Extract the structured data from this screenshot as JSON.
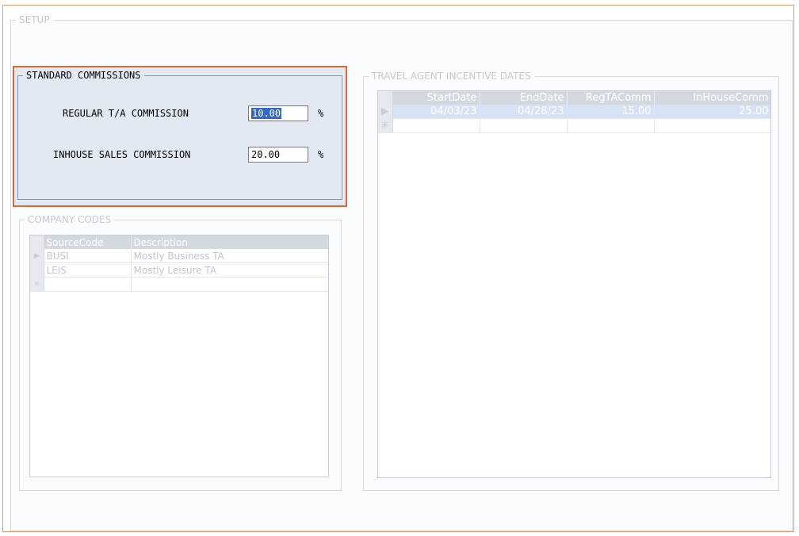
{
  "setup": {
    "title": "SETUP"
  },
  "standard_commissions": {
    "title": "STANDARD COMMISSIONS",
    "regular_label": "REGULAR T/A COMMISSION",
    "regular_value": "10.00",
    "inhouse_label": "INHOUSE SALES COMMISSION",
    "inhouse_value": "20.00",
    "percent_sign": "%"
  },
  "company_codes": {
    "title": "COMPANY CODES",
    "columns": [
      "SourceCode",
      "Description"
    ],
    "rows": [
      {
        "code": "BUSI",
        "description": "Mostly Business TA"
      },
      {
        "code": "LEIS",
        "description": "Mostly Leisure TA"
      }
    ],
    "current_row_glyph": "▶",
    "new_row_glyph": "✳"
  },
  "travel_agent": {
    "title": "TRAVEL AGENT INCENTIVE DATES",
    "columns": [
      "StartDate",
      "EndDate",
      "RegTAComm",
      "InHouseComm"
    ],
    "rows": [
      {
        "start": "04/03/23",
        "end": "04/28/23",
        "reg": "15.00",
        "inhouse": "25.00"
      }
    ],
    "current_row_glyph": "▶",
    "new_row_glyph": "✳"
  },
  "colors": {
    "accent": "#e06a36",
    "panel": "#e3e9f3",
    "selection": "#3169c6"
  }
}
